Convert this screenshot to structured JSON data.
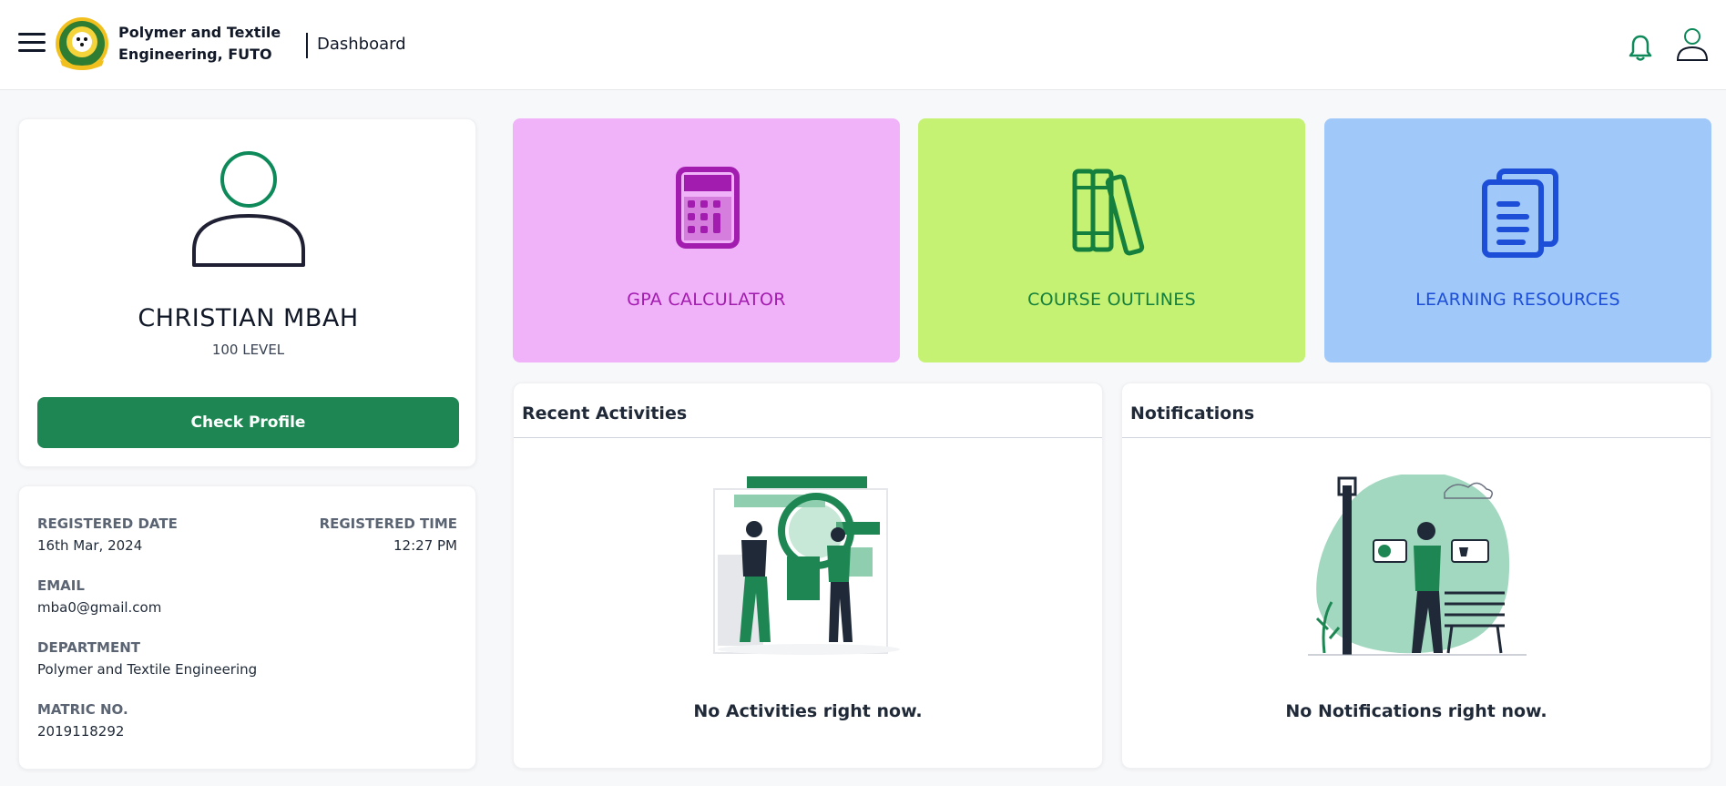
{
  "header": {
    "brand_line1": "Polymer and Textile",
    "brand_line2": "Engineering, FUTO",
    "page_title": "Dashboard",
    "icons": [
      "menu-icon",
      "logo",
      "bell-icon",
      "user-icon"
    ]
  },
  "profile": {
    "name": "CHRISTIAN MBAH",
    "level": "100 LEVEL",
    "button_label": "Check Profile"
  },
  "details": {
    "registered_date_label": "REGISTERED DATE",
    "registered_date": "16th Mar, 2024",
    "registered_time_label": "REGISTERED TIME",
    "registered_time": "12:27 PM",
    "email_label": "EMAIL",
    "email": "mba0@gmail.com",
    "department_label": "DEPARTMENT",
    "department": "Polymer and Textile Engineering",
    "matric_label": "MATRIC NO.",
    "matric": "2019118292"
  },
  "tiles": [
    {
      "label": "GPA CALCULATOR",
      "color": "#a21caf",
      "bg": "#f0b2f8",
      "icon": "calculator-icon"
    },
    {
      "label": "COURSE OUTLINES",
      "color": "#15803d",
      "bg": "#c5f272",
      "icon": "books-icon"
    },
    {
      "label": "LEARNING RESOURCES",
      "color": "#1d4ed8",
      "bg": "#a0c8f8",
      "icon": "documents-icon"
    }
  ],
  "activities": {
    "title": "Recent Activities",
    "empty_message": "No Activities right now."
  },
  "notifications": {
    "title": "Notifications",
    "empty_message": "No Notifications right now."
  },
  "colors": {
    "primary_green": "#1e8653",
    "accent_green": "#0e8a5a"
  }
}
